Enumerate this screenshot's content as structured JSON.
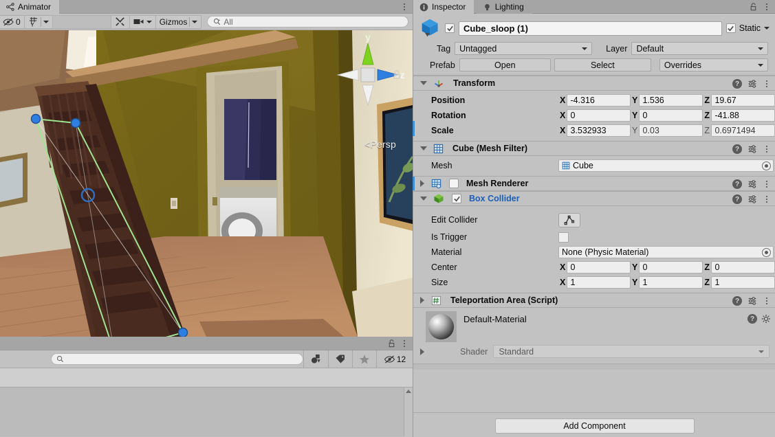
{
  "scene_panel": {
    "tab_label": "Animator",
    "tab_icon": "animator-icon",
    "toolbar": {
      "hidden_count": "0",
      "hidden_icon": "eye-off-icon",
      "grid_icon": "grid-snap-icon",
      "tools_icon": "tools-icon",
      "camera_icon": "scene-camera-icon",
      "gizmos_label": "Gizmos",
      "search_placeholder": "All",
      "search_value": "",
      "search_icon": "search-icon"
    },
    "viewport": {
      "orientation_label": "Persp",
      "axis_y": "y",
      "axis_z": "z",
      "lock_icon": "lock-open-icon",
      "handle_color": "#2f7fe0",
      "outline_color": "#97e08a"
    }
  },
  "project_panel": {
    "search_placeholder": "",
    "search_value": "",
    "search_icon": "search-icon",
    "lock_icon": "lock-open-icon",
    "buttons": [
      {
        "name": "filter-by-type-icon",
        "label": ""
      },
      {
        "name": "filter-by-label-icon",
        "label": ""
      },
      {
        "name": "favorites-star-icon",
        "label": ""
      }
    ],
    "hidden_count": "12",
    "hidden_icon": "eye-off-icon"
  },
  "inspector": {
    "tabs": [
      {
        "label": "Inspector",
        "icon": "info-icon",
        "active": true
      },
      {
        "label": "Lighting",
        "icon": "lightbulb-icon",
        "active": false
      }
    ],
    "lock_icon": "lock-open-icon",
    "header": {
      "object_icon": "cube-prefab-icon",
      "enabled": true,
      "name": "Cube_sloop (1)",
      "static_label": "Static",
      "static_checked": true,
      "tag_label": "Tag",
      "tag_value": "Untagged",
      "layer_label": "Layer",
      "layer_value": "Default",
      "prefab_label": "Prefab",
      "open_label": "Open",
      "select_label": "Select",
      "overrides_label": "Overrides"
    },
    "components": [
      {
        "id": "transform",
        "title": "Transform",
        "icon": "transform-axis-icon",
        "expanded": true,
        "has_checkbox": false,
        "accent": true,
        "rows": [
          {
            "label": "Position",
            "x": "-4.316",
            "y": "1.536",
            "z": "19.67",
            "dim": false
          },
          {
            "label": "Rotation",
            "x": "0",
            "y": "0",
            "z": "-41.88",
            "dim": false
          },
          {
            "label": "Scale",
            "x": "3.532933",
            "y": "0.03",
            "z": "0.6971494",
            "dim": true
          }
        ]
      },
      {
        "id": "mesh-filter",
        "title": "Cube (Mesh Filter)",
        "icon": "mesh-filter-icon",
        "expanded": true,
        "has_checkbox": false,
        "mesh_label": "Mesh",
        "mesh_value": "Cube",
        "mesh_value_icon": "mesh-icon"
      },
      {
        "id": "mesh-renderer",
        "title": "Mesh Renderer",
        "icon": "mesh-renderer-icon",
        "expanded": false,
        "has_checkbox": true,
        "checked": false,
        "accent": true
      },
      {
        "id": "box-collider",
        "title": "Box Collider",
        "icon": "box-collider-icon",
        "expanded": true,
        "has_checkbox": true,
        "checked": true,
        "title_blue": true,
        "rows": {
          "edit_collider_label": "Edit Collider",
          "edit_collider_icon": "edit-collider-icon",
          "is_trigger_label": "Is Trigger",
          "is_trigger_checked": false,
          "material_label": "Material",
          "material_value": "None (Physic Material)",
          "center_label": "Center",
          "center": {
            "x": "0",
            "y": "0",
            "z": "0"
          },
          "size_label": "Size",
          "size": {
            "x": "1",
            "y": "1",
            "z": "1"
          }
        }
      },
      {
        "id": "teleportation-area",
        "title": "Teleportation Area (Script)",
        "icon": "script-hash-icon",
        "expanded": false,
        "has_checkbox": false
      }
    ],
    "material": {
      "preview_icon": "material-sphere-preview",
      "name": "Default-Material",
      "shader_label": "Shader",
      "shader_value": "Standard",
      "help_icon": "help-icon",
      "settings_icon": "gear-icon",
      "expand_icon": "triangle-right-icon"
    },
    "add_component_label": "Add Component"
  },
  "icons": {
    "help": "?",
    "kebab": "kebab-menu-icon"
  },
  "colors": {
    "panel_bg": "#c2c2c2",
    "tabbar_bg": "#a5a5a5",
    "field_bg": "#eeeeee",
    "accent_blue": "#3d8fd6",
    "link_blue": "#1b5fb8",
    "selection_green": "#97e08a",
    "handle_blue": "#2f7fe0"
  }
}
